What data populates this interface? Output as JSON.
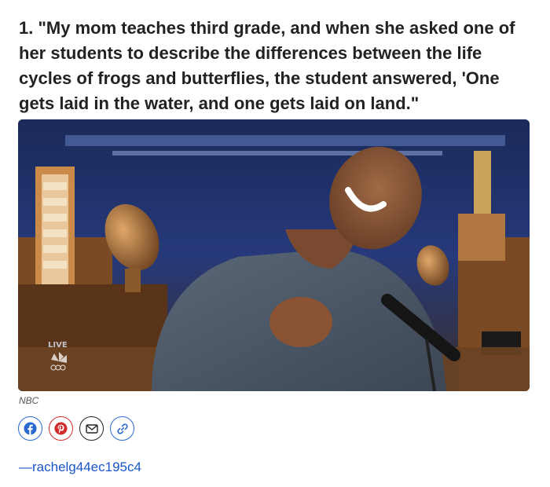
{
  "article": {
    "headline": "1. \"My mom teaches third grade, and when she asked one of her students to describe the differences between the life cycles of frogs and butterflies, the student answered, 'One gets laid in the water, and one gets laid on land.\"",
    "image_credit": "NBC",
    "watermark_text": "LIVE",
    "author_link": "—rachelg44ec195c4"
  },
  "share": {
    "buttons": [
      {
        "name": "facebook",
        "icon": "facebook-icon",
        "color": "#2a6ad0"
      },
      {
        "name": "pinterest",
        "icon": "pinterest-icon",
        "color": "#d22b2b"
      },
      {
        "name": "email",
        "icon": "envelope-icon",
        "color": "#222222"
      },
      {
        "name": "copy-link",
        "icon": "link-icon",
        "color": "#2a6ad0"
      }
    ]
  },
  "colors": {
    "link": "#1a55c9",
    "headline": "#222222"
  }
}
